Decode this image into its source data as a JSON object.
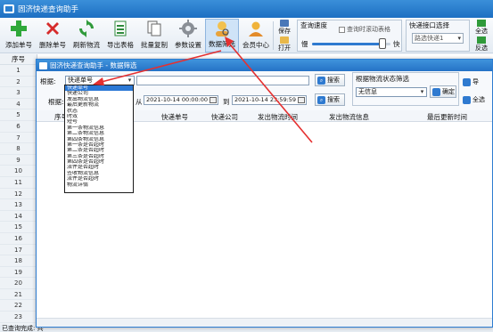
{
  "app": {
    "title": "固济快递查询助手"
  },
  "toolbar": {
    "buttons": [
      {
        "label": "添加单号",
        "icon": "plus-icon"
      },
      {
        "label": "删除单号",
        "icon": "delete-x-icon"
      },
      {
        "label": "刷新物流",
        "icon": "refresh-icon"
      },
      {
        "label": "导出表格",
        "icon": "export-sheet-icon"
      },
      {
        "label": "批量复制",
        "icon": "copy-icon"
      },
      {
        "label": "参数设置",
        "icon": "gear-icon"
      },
      {
        "label": "数据筛选",
        "icon": "filter-user-icon"
      },
      {
        "label": "会员中心",
        "icon": "member-icon"
      }
    ],
    "save_label": "保存",
    "open_label": "打开",
    "speed": {
      "title": "查询速度",
      "auto_scroll_label": "查询时滚动表格",
      "slow": "慢",
      "fast": "快",
      "level": 0.9
    },
    "interface": {
      "title": "快递接口选择",
      "value": "路选快递1"
    },
    "select_all_label": "全选",
    "invert_label": "反选"
  },
  "grid": {
    "header": "序号",
    "row_numbers": [
      "1",
      "2",
      "3",
      "4",
      "5",
      "6",
      "7",
      "8",
      "9",
      "10",
      "11",
      "12",
      "13",
      "14",
      "15",
      "16",
      "17",
      "18",
      "19",
      "20",
      "21",
      "22",
      "23"
    ]
  },
  "status": {
    "text": "已查询完成: 共"
  },
  "dialog": {
    "title": "固济快递查询助手 - 数据筛选",
    "by_label": "根据:",
    "by_value": "快递单号",
    "search_label": "搜索",
    "by_label2": "根据:",
    "from_label": "从",
    "from_date": "2021-10-14 00:00:00",
    "to_label": "到",
    "to_date": "2021-10-14 23:59:59",
    "status_group_title": "根据物流状态筛选",
    "status_value": "无信息",
    "confirm_label": "确定",
    "export_label": "导",
    "select_all_label": "全选",
    "columns": [
      "序号",
      "快递单号",
      "快递公司",
      "发出物流时间",
      "发出物流信息",
      "最后更新时间"
    ],
    "dropdown_items": [
      "快递单号",
      "快递公司",
      "发出物流信息",
      "最后更新物流",
      "状态",
      "时效",
      "短号",
      "第一条物流信息",
      "第二条物流信息",
      "第四条物流信息",
      "第一条是否超时",
      "第二条是否超时",
      "第三条是否超时",
      "第四条是否超时",
      "派件是否超时",
      "签收物流信息",
      "派件是否超时",
      "物流详情"
    ],
    "selected_index": 0
  }
}
